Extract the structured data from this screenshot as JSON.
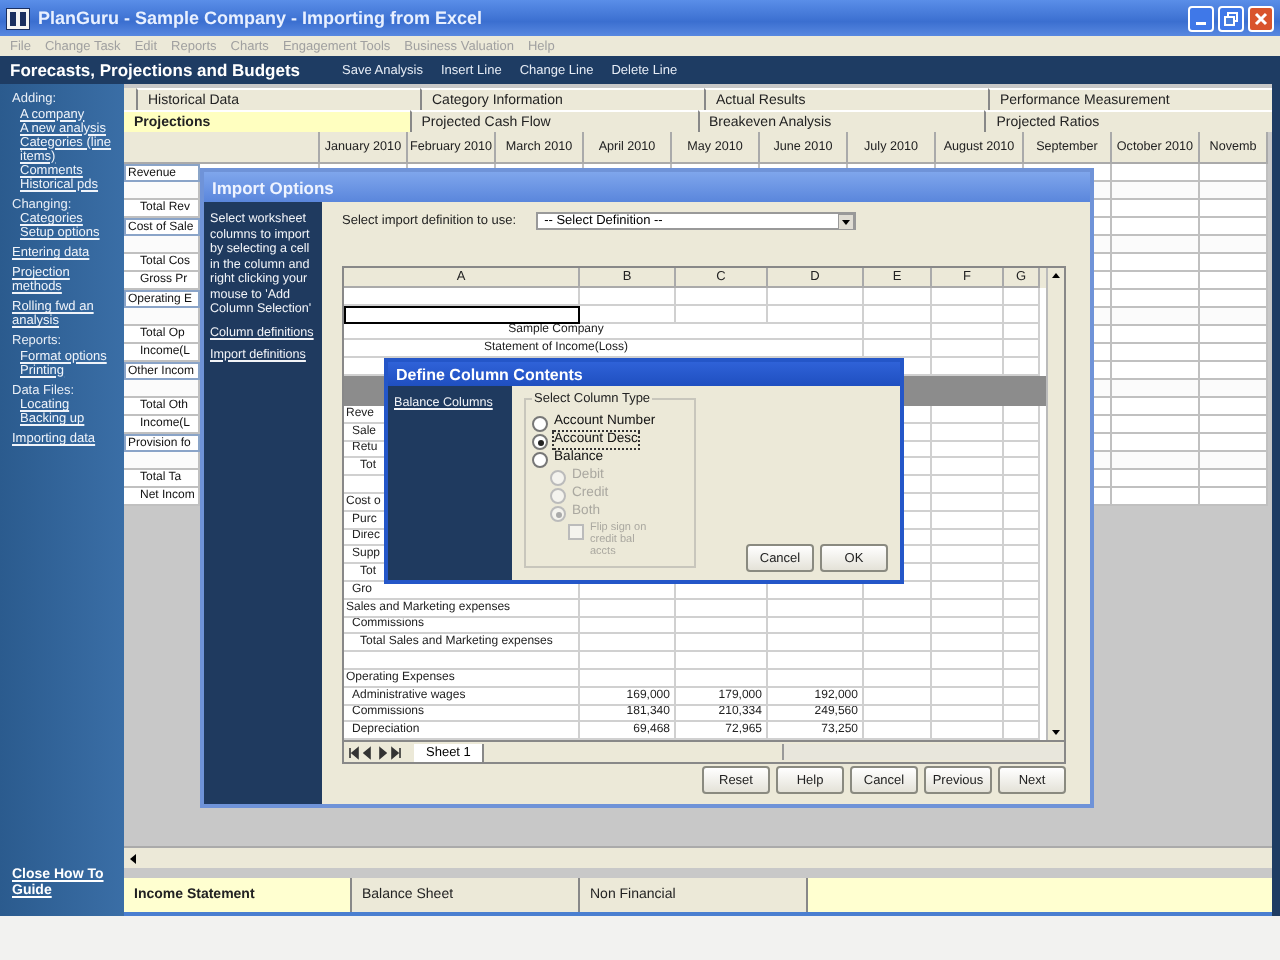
{
  "window": {
    "title": "PlanGuru - Sample Company - Importing from Excel"
  },
  "menu": [
    "File",
    "Change Task",
    "Edit",
    "Reports",
    "Charts",
    "Engagement Tools",
    "Business Valuation",
    "Help"
  ],
  "toolbar": {
    "title": "Forecasts, Projections and Budgets",
    "buttons": [
      "Save Analysis",
      "Insert Line",
      "Change Line",
      "Delete Line"
    ]
  },
  "sidebar": {
    "groups": [
      {
        "heading": "Adding:",
        "links": [
          "A company",
          "A new analysis",
          "Categories (line items)",
          "Comments",
          "Historical pds"
        ]
      },
      {
        "heading": "Changing:",
        "links": [
          "Categories",
          "Setup options"
        ]
      },
      {
        "links": [
          "Entering data"
        ]
      },
      {
        "links": [
          "Projection methods"
        ]
      },
      {
        "links": [
          "Rolling fwd an analysis"
        ]
      },
      {
        "heading": "Reports:",
        "links": [
          "Format options",
          "Printing"
        ]
      },
      {
        "heading": "Data Files:",
        "links": [
          "Locating",
          "Backing up"
        ]
      },
      {
        "links": [
          "Importing data"
        ]
      }
    ],
    "footer_link": "Close How To Guide"
  },
  "tab_rows": [
    [
      {
        "label": "Historical Data",
        "selected": false
      },
      {
        "label": "Category Information",
        "selected": false
      },
      {
        "label": "Actual Results",
        "selected": false
      },
      {
        "label": "Performance Measurement",
        "selected": false
      }
    ],
    [
      {
        "label": "Projections",
        "selected": true
      },
      {
        "label": "Projected Cash Flow",
        "selected": false
      },
      {
        "label": "Breakeven Analysis",
        "selected": false
      },
      {
        "label": "Projected Ratios",
        "selected": false
      }
    ]
  ],
  "grid": {
    "columns": [
      "January 2010",
      "February 2010",
      "March 2010",
      "April 2010",
      "May 2010",
      "June 2010",
      "July 2010",
      "August 2010",
      "September",
      "October 2010",
      "Novemb"
    ],
    "rows": [
      {
        "kind": "heading",
        "label": "Revenue"
      },
      {
        "kind": "blank"
      },
      {
        "kind": "total",
        "label": "Total Rev"
      },
      {
        "kind": "heading",
        "label": "Cost of Sale"
      },
      {
        "kind": "blank"
      },
      {
        "kind": "total",
        "label": "Total Cos"
      },
      {
        "kind": "total",
        "label": "Gross Pr"
      },
      {
        "kind": "heading",
        "label": "Operating E"
      },
      {
        "kind": "blank"
      },
      {
        "kind": "total",
        "label": "Total Op"
      },
      {
        "kind": "total",
        "label": "Income(L"
      },
      {
        "kind": "heading",
        "label": "Other Incom"
      },
      {
        "kind": "blank"
      },
      {
        "kind": "total",
        "label": "Total Oth"
      },
      {
        "kind": "total",
        "label": "Income(L"
      },
      {
        "kind": "heading",
        "label": "Provision fo"
      },
      {
        "kind": "blank"
      },
      {
        "kind": "total",
        "label": "Total Ta"
      },
      {
        "kind": "total",
        "label": "Net Incom"
      }
    ]
  },
  "bottom_tabs": [
    {
      "label": "Income Statement",
      "selected": true
    },
    {
      "label": "Balance Sheet",
      "selected": false
    },
    {
      "label": "Non Financial",
      "selected": false
    }
  ],
  "import_dialog": {
    "title": "Import Options",
    "instructions": "Select worksheet columns to import by selecting a cell in the column and right clicking your mouse to 'Add Column Selection'",
    "links": [
      "Column definitions",
      "Import definitions"
    ],
    "definition_label": "Select import definition to use:",
    "definition_value": "-- Select Definition --",
    "sheet": {
      "columns": [
        "A",
        "B",
        "C",
        "D",
        "E",
        "F",
        "G"
      ],
      "rows": [
        {
          "kind": "blank",
          "selected": false
        },
        {
          "kind": "blank",
          "selected": true
        },
        {
          "kind": "title",
          "a": "Sample Company",
          "selected": false
        },
        {
          "kind": "title",
          "a": "Statement of Income(Loss)",
          "selected": false
        },
        {
          "kind": "blank",
          "selected": false
        },
        {
          "kind": "band",
          "selected": false
        },
        {
          "kind": "heading",
          "a": "Reve",
          "selected": false
        },
        {
          "kind": "item",
          "a": "Sale",
          "selected": false
        },
        {
          "kind": "item",
          "a": "Retu",
          "selected": false
        },
        {
          "kind": "total",
          "a": "Tot",
          "selected": false
        },
        {
          "kind": "blank",
          "selected": false
        },
        {
          "kind": "heading",
          "a": "Cost o",
          "selected": false
        },
        {
          "kind": "item",
          "a": "Purc",
          "selected": false
        },
        {
          "kind": "item",
          "a": "Direc",
          "selected": false
        },
        {
          "kind": "item",
          "a": "Supp",
          "selected": false
        },
        {
          "kind": "total",
          "a": "Tot",
          "selected": false
        },
        {
          "kind": "item",
          "a": "Gro",
          "selected": false
        },
        {
          "kind": "heading",
          "a": "Sales and Marketing expenses",
          "selected": false
        },
        {
          "kind": "item",
          "a": "Commissions",
          "selected": false
        },
        {
          "kind": "total",
          "a": "Total Sales and Marketing expenses",
          "selected": false
        },
        {
          "kind": "blank",
          "selected": false
        },
        {
          "kind": "heading",
          "a": "Operating Expenses",
          "selected": false
        },
        {
          "kind": "item",
          "a": "Administrative wages",
          "b": "169,000",
          "c": "179,000",
          "d": "192,000",
          "selected": false
        },
        {
          "kind": "item",
          "a": "Commissions",
          "b": "181,340",
          "c": "210,334",
          "d": "249,560",
          "selected": false
        },
        {
          "kind": "item",
          "a": "Depreciation",
          "b": "69,468",
          "c": "72,965",
          "d": "73,250",
          "selected": false
        }
      ],
      "tabs": [
        "Sheet 1"
      ]
    },
    "buttons": [
      "Reset",
      "Help",
      "Cancel",
      "Previous",
      "Next"
    ]
  },
  "column_dialog": {
    "title": "Define Column Contents",
    "link": "Balance Columns",
    "group": "Select Column Type",
    "options": [
      {
        "kind": "radio",
        "label": "Account Number",
        "selected": false,
        "disabled": false
      },
      {
        "kind": "radio",
        "label": "Account Desc",
        "selected": true,
        "disabled": false
      },
      {
        "kind": "radio",
        "label": "Balance",
        "selected": false,
        "disabled": false,
        "children": [
          {
            "kind": "radio",
            "label": "Debit",
            "selected": false,
            "disabled": true
          },
          {
            "kind": "radio",
            "label": "Credit",
            "selected": false,
            "disabled": true
          },
          {
            "kind": "radio",
            "label": "Both",
            "selected": true,
            "disabled": true,
            "children": [
              {
                "kind": "checkbox",
                "label": "Flip sign on credit bal accts",
                "checked": false,
                "disabled": true
              }
            ]
          }
        ]
      }
    ],
    "buttons": [
      "Cancel",
      "OK"
    ]
  }
}
